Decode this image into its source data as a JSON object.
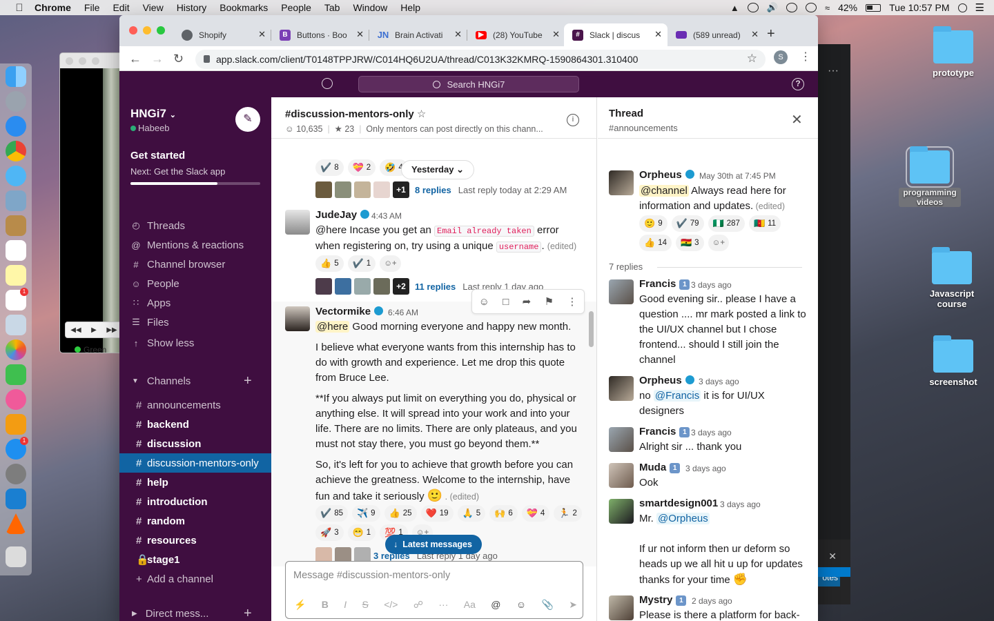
{
  "menubar": {
    "app": "Chrome",
    "items": [
      "File",
      "Edit",
      "View",
      "History",
      "Bookmarks",
      "People",
      "Tab",
      "Window",
      "Help"
    ],
    "battery": "42%",
    "clock": "Tue 10:57 PM"
  },
  "desktop": {
    "icons": [
      "prototype",
      "programming videos",
      "Javascript course",
      "screenshot"
    ]
  },
  "bg_window": {
    "status": "Green",
    "vscode_button": "otes"
  },
  "tabs": [
    {
      "title": "Shopify",
      "color": "#5f6368"
    },
    {
      "title": "Buttons · Boo",
      "color": "#7b3fb5"
    },
    {
      "title": "Brain Activati",
      "color": "#3c6fd1"
    },
    {
      "title": "(28) YouTube",
      "color": "#ff0000"
    },
    {
      "title": "Slack | discus",
      "color": "#4a154b"
    },
    {
      "title": "(589 unread)",
      "color": "#6a2db3"
    }
  ],
  "url": "app.slack.com/client/T0148TPPJRW/C014HQ6U2UA/thread/C013K32KMRQ-1590864301.310400",
  "profile_initial": "S",
  "slack": {
    "search": "Search HNGi7",
    "workspace": "HNGi7",
    "user": "Habeeb",
    "get_started": "Get started",
    "next_step": "Next: Get the Slack app",
    "progress": 0.67,
    "nav": [
      {
        "label": "Threads",
        "icon": "threads-icon"
      },
      {
        "label": "Mentions & reactions",
        "icon": "at-icon"
      },
      {
        "label": "Channel browser",
        "icon": "channel-browser-icon"
      },
      {
        "label": "People",
        "icon": "people-icon"
      },
      {
        "label": "Apps",
        "icon": "apps-icon"
      },
      {
        "label": "Files",
        "icon": "files-icon"
      },
      {
        "label": "Show less",
        "icon": "arrow-up-icon"
      }
    ],
    "channels_label": "Channels",
    "channels": [
      {
        "name": "announcements",
        "bold": false
      },
      {
        "name": "backend",
        "bold": true
      },
      {
        "name": "discussion",
        "bold": true
      },
      {
        "name": "discussion-mentors-only",
        "bold": true,
        "active": true
      },
      {
        "name": "help",
        "bold": true
      },
      {
        "name": "introduction",
        "bold": true
      },
      {
        "name": "random",
        "bold": true
      },
      {
        "name": "resources",
        "bold": true
      },
      {
        "name": "stage1",
        "bold": true,
        "lock": true
      }
    ],
    "add_channel": "Add a channel",
    "dm_label": "Direct mess...",
    "channel": {
      "name": "#discussion-mentors-only",
      "members": "10,635",
      "pins": "23",
      "topic": "Only mentors can post directly on this chann..."
    },
    "day_sep": "Yesterday",
    "top_reacts": [
      [
        "✔️",
        "8"
      ],
      [
        "💝",
        "2"
      ],
      [
        "🤣",
        "4"
      ]
    ],
    "top_thread": {
      "extra": "+1",
      "replies": "8 replies",
      "last": "Last reply today at 2:29 AM"
    },
    "msg1": {
      "name": "JudeJay",
      "time": "4:43 AM",
      "p1": "@here Incase you get an ",
      "code1": "Email already taken",
      "p2": " error when registering on, try using a unique ",
      "code2": "username",
      "p3": ".",
      "edited": "(edited)",
      "reacts": [
        [
          "👍",
          "5"
        ],
        [
          "✔️",
          "1"
        ]
      ],
      "thread": {
        "extra": "+2",
        "replies": "11 replies",
        "last": "Last reply 1 day ago"
      }
    },
    "msg2": {
      "name": "Vectormike",
      "time": "6:46 AM",
      "here": "@here",
      "line1": " Good morning everyone and happy new month.",
      "para2": "I believe what everyone wants from this internship has to do with growth and experience. Let me drop this quote from Bruce Lee.",
      "para3": "**If you always put limit on everything you do, physical or anything else. It will spread into your work and into your life. There are no limits. There are only plateaus, and you must not stay there, you must go beyond them.**",
      "para4": "So, it's left for you to achieve that growth before you can achieve the greatness. Welcome to the internship, have fun and take it seriously ",
      "emoji": "🙂",
      "edited": " . (edited)",
      "reacts1": [
        [
          "✔️",
          "85"
        ],
        [
          "✈️",
          "9"
        ],
        [
          "👍",
          "25"
        ],
        [
          "❤️",
          "19"
        ],
        [
          "🙏",
          "5"
        ],
        [
          "🙌",
          "6"
        ],
        [
          "💝",
          "4"
        ],
        [
          "🏃",
          "2"
        ]
      ],
      "reacts2": [
        [
          "🚀",
          "3"
        ],
        [
          "😁",
          "1"
        ],
        [
          "💯",
          "1"
        ]
      ],
      "thread": {
        "replies": "3 replies",
        "last": "Last reply 1 day ago"
      }
    },
    "latest": "Latest messages",
    "composer_placeholder": "Message #discussion-mentors-only",
    "thread_panel": {
      "title": "Thread",
      "sub": "#announcements",
      "root": {
        "name": "Orpheus",
        "time": "May 30th at 7:45 PM",
        "mention": "@channel",
        "text": " Always read here for information and updates.",
        "edited": " (edited)",
        "reacts1": [
          [
            "🙂",
            "9"
          ],
          [
            "✔️",
            "79"
          ],
          [
            "🇳🇬",
            "287"
          ],
          [
            "🇨🇲",
            "11"
          ]
        ],
        "reacts2": [
          [
            "👍",
            "14"
          ],
          [
            "🇬🇭",
            "3"
          ]
        ]
      },
      "replies_count": "7 replies",
      "replies": [
        {
          "name": "Francis",
          "badge": "1",
          "time": "3 days ago",
          "text": "Good evening sir.. please I have a question .... mr mark posted a link to the  UI/UX channel but I chose frontend... should I still join the channel"
        },
        {
          "name": "Orpheus",
          "time": "3 days ago",
          "pre": "no ",
          "mention": "@Francis",
          "text": " it is for UI/UX designers"
        },
        {
          "name": "Francis",
          "badge": "1",
          "time": "3 days ago",
          "text": "Alright sir ... thank you"
        },
        {
          "name": "Muda",
          "badge": "1",
          "time": "3 days ago",
          "text": "Ook"
        },
        {
          "name": "smartdesign001",
          "time": "3 days ago",
          "pre": "Mr. ",
          "mention": "@Orpheus",
          "text": "If ur not inform then ur deform so heads up we all hit u up for updates thanks for your time",
          "emoji": "✊"
        },
        {
          "name": "Mystry",
          "badge": "1",
          "time": "2 days ago",
          "text": "Please is there a platform for back-end dev?"
        }
      ]
    }
  }
}
